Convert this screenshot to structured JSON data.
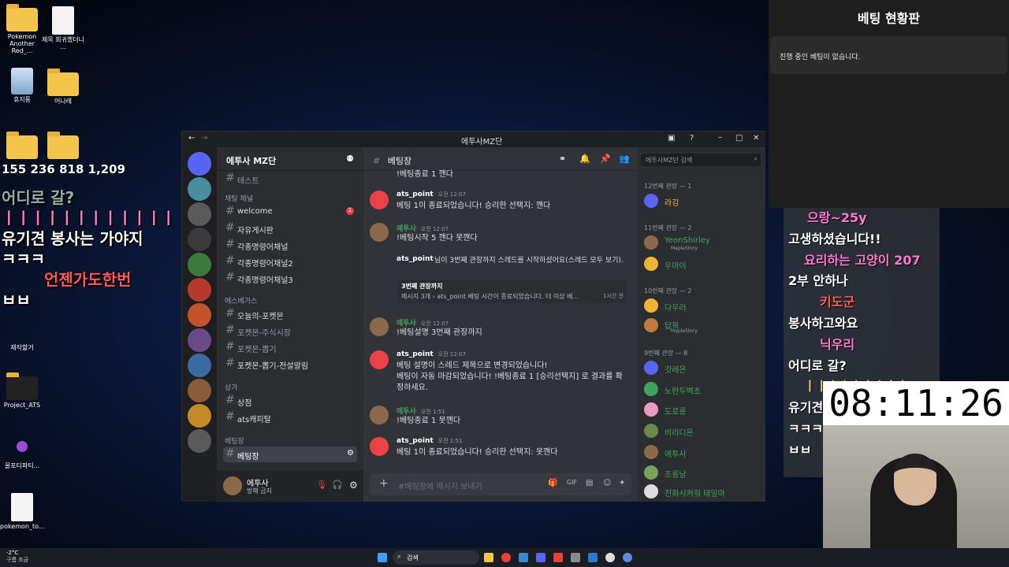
{
  "desktop": {
    "icons": [
      {
        "label": "Pokemon Another Red_..."
      },
      {
        "label": "제목 회귀했더니 ..."
      },
      {
        "label": "휴지통"
      },
      {
        "label": "어나레"
      },
      {
        "label": "제작할거"
      },
      {
        "label": "Project_ATS"
      },
      {
        "label": "꿀포티파티..."
      },
      {
        "label": "pokemon_to..."
      }
    ]
  },
  "stream_overlay": {
    "stats": "155 236 818 1,209",
    "lines": [
      "어디로 갈?",
      "ㅣㅣㅣㅣㅣㅣㅣㅣㅣㅣㅣㅣㅣ",
      "유기견 봉사는 가야지",
      "ㅋㅋㅋ",
      "언젠가도한번",
      "ㅂㅂ"
    ]
  },
  "discord": {
    "title": "에투사MZ단",
    "server_name": "에투사 MZ단",
    "categories": {
      "chat": "채팅 채널",
      "events": "에스베가스",
      "shop": "상가",
      "betting": "베팅장"
    },
    "channels": [
      "테스트",
      "welcome",
      "자유게시판",
      "각종명령어채널",
      "각종명령어채널2",
      "각종명령어채널3",
      "오늘의-포켓몬",
      "포켓몬-주식시장",
      "포켓몬-뽑기",
      "포켓몬-뽑기-전설알림",
      "상점",
      "ats캐피탈",
      "베팅장"
    ],
    "welcome_badge": "1",
    "current_channel": "베팅장",
    "user": {
      "name": "에투사",
      "status": "방해 금지"
    },
    "messages": [
      {
        "author": "",
        "time": "",
        "text": "!베팅종료 1 깬다"
      },
      {
        "author": "ats_point",
        "time": "오전 12:07",
        "text": "베팅 1이 종료되었습니다! 승리한 선택지: 깬다"
      },
      {
        "author": "에투사",
        "time": "오전 12:07",
        "text": "!베팅시작 5 깬다 못깬다"
      },
      {
        "author": "ats_point",
        "time": "오전 12:07",
        "text": "님이 3번째 관장까지 스레드를 시작하셨어요(스레드 모두 보기)."
      },
      {
        "author": "3번째 관장까지",
        "time": "1시간 전",
        "text": "메시지 3개 › ats_point 베팅 시간이 종료되었습니다. 더 이상 베..."
      },
      {
        "author": "에투사",
        "time": "오전 12:07",
        "text": "!베팅설명 3번째 관장까지"
      },
      {
        "author": "ats_point",
        "time": "오전 12:07",
        "text": "베팅 설명이 스레드 제목으로 변경되었습니다!"
      },
      {
        "author": "",
        "time": "",
        "text": "베팅이 자동 마감되었습니다! !베팅종료 1 [승리선택지] 로 결과를 확정하세요."
      },
      {
        "author": "에투사",
        "time": "오전 1:51",
        "text": "!베팅종료 1 못깬다"
      },
      {
        "author": "ats_point",
        "time": "오전 1:51",
        "text": "베팅 1이 종료되었습니다! 승리한 선택지: 못깬다"
      }
    ],
    "input_placeholder": "#베팅장에 메시지 보내기",
    "search_placeholder": "에투사MZ단 검색",
    "members": {
      "groups": [
        {
          "title": "12번째 관장 — 1",
          "names": [
            "라깅"
          ]
        },
        {
          "title": "11번째 관장 — 2",
          "names": [
            "YeonShirley",
            "우마이"
          ]
        },
        {
          "title": "10번째 관장 — 2",
          "names": [
            "다우러",
            "답목"
          ]
        },
        {
          "title": "9번째 관장 — 8",
          "names": [
            "갓레온",
            "노란두벽초",
            "도로롱",
            "비리디온",
            "에투사",
            "조롱낭",
            "진화시켜줘 태일아"
          ]
        }
      ],
      "maplestory": "MapleStory"
    }
  },
  "betting_panel": {
    "title": "베팅 현황판",
    "status": "진행 중인 베팅이 없습니다."
  },
  "chat_log": [
    "으랑~25y",
    "고생하셨습니다!!",
    "요리하는 고양이 207",
    "2부 안하나",
    "키도군",
    "봉사하고와요",
    "닉우리",
    "어디로 갈?",
    "ㅣㅣㅣㅣㅣㅣㅣㅣㅣ",
    "유기견 봉사는",
    "ㅋㅋㅋ",
    "ㅂㅂ"
  ],
  "clock": "08:11:26",
  "taskbar": {
    "search": "검색",
    "weather": "-2°C",
    "weather_desc": "구름 조금"
  }
}
